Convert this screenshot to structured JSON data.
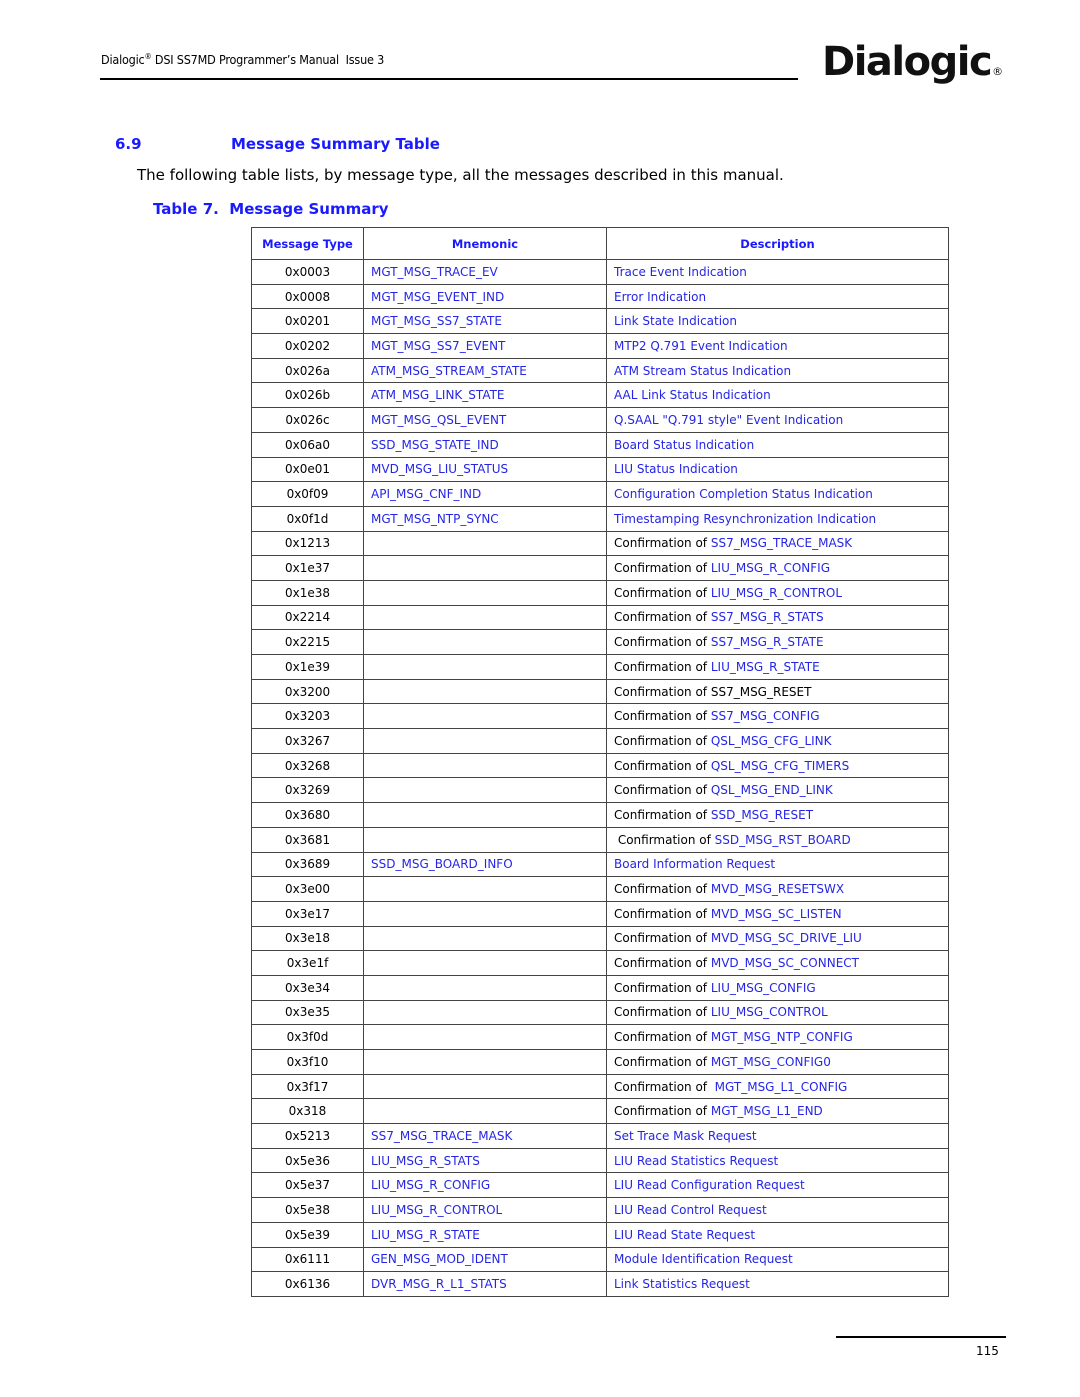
{
  "header": {
    "brand": "Dialogic",
    "reg_mark": "®",
    "title_rest": " DSI SS7MD Programmer’s Manual  Issue 3",
    "logo_text": "Dialogic",
    "logo_reg": "®"
  },
  "section": {
    "number": "6.9",
    "title": "Message Summary Table",
    "intro": "The following table lists, by message type, all the messages described in this manual."
  },
  "table": {
    "caption": "Table 7.  Message Summary",
    "columns": [
      "Message Type",
      "Mnemonic",
      "Description"
    ],
    "rows": [
      {
        "type": "0x0003",
        "mnemonic": "MGT_MSG_TRACE_EV",
        "desc_prefix": "",
        "desc": "Trace Event Indication",
        "desc_link": true
      },
      {
        "type": "0x0008",
        "mnemonic": "MGT_MSG_EVENT_IND",
        "desc_prefix": "",
        "desc": "Error Indication",
        "desc_link": true
      },
      {
        "type": "0x0201",
        "mnemonic": "MGT_MSG_SS7_STATE",
        "desc_prefix": "",
        "desc": "Link State Indication",
        "desc_link": true
      },
      {
        "type": "0x0202",
        "mnemonic": "MGT_MSG_SS7_EVENT",
        "desc_prefix": "",
        "desc": "MTP2 Q.791 Event Indication",
        "desc_link": true
      },
      {
        "type": "0x026a",
        "mnemonic": "ATM_MSG_STREAM_STATE",
        "desc_prefix": "",
        "desc": "ATM Stream Status Indication",
        "desc_link": true
      },
      {
        "type": "0x026b",
        "mnemonic": "ATM_MSG_LINK_STATE",
        "desc_prefix": "",
        "desc": "AAL Link Status Indication",
        "desc_link": true
      },
      {
        "type": "0x026c",
        "mnemonic": "MGT_MSG_QSL_EVENT",
        "desc_prefix": "",
        "desc": "Q.SAAL \"Q.791 style\" Event Indication",
        "desc_link": true
      },
      {
        "type": "0x06a0",
        "mnemonic": "SSD_MSG_STATE_IND",
        "desc_prefix": "",
        "desc": "Board Status Indication",
        "desc_link": true
      },
      {
        "type": "0x0e01",
        "mnemonic": "MVD_MSG_LIU_STATUS",
        "desc_prefix": "",
        "desc": "LIU Status Indication",
        "desc_link": true
      },
      {
        "type": "0x0f09",
        "mnemonic": "API_MSG_CNF_IND",
        "desc_prefix": "",
        "desc": "Configuration Completion Status Indication",
        "desc_link": true
      },
      {
        "type": "0x0f1d",
        "mnemonic": "MGT_MSG_NTP_SYNC",
        "desc_prefix": "",
        "desc": "Timestamping Resynchronization Indication",
        "desc_link": true
      },
      {
        "type": "0x1213",
        "mnemonic": "",
        "desc_prefix": "Confirmation of ",
        "desc": "SS7_MSG_TRACE_MASK",
        "desc_link": true
      },
      {
        "type": "0x1e37",
        "mnemonic": "",
        "desc_prefix": "Confirmation of ",
        "desc": "LIU_MSG_R_CONFIG",
        "desc_link": true
      },
      {
        "type": "0x1e38",
        "mnemonic": "",
        "desc_prefix": "Confirmation of ",
        "desc": "LIU_MSG_R_CONTROL",
        "desc_link": true
      },
      {
        "type": "0x2214",
        "mnemonic": "",
        "desc_prefix": "Confirmation of ",
        "desc": "SS7_MSG_R_STATS",
        "desc_link": true
      },
      {
        "type": "0x2215",
        "mnemonic": "",
        "desc_prefix": "Confirmation of ",
        "desc": "SS7_MSG_R_STATE",
        "desc_link": true
      },
      {
        "type": "0x1e39",
        "mnemonic": "",
        "desc_prefix": "Confirmation of ",
        "desc": "LIU_MSG_R_STATE",
        "desc_link": true
      },
      {
        "type": "0x3200",
        "mnemonic": "",
        "desc_prefix": "Confirmation of ",
        "desc": "SS7_MSG_RESET",
        "desc_link": false
      },
      {
        "type": "0x3203",
        "mnemonic": "",
        "desc_prefix": "Confirmation of ",
        "desc": "SS7_MSG_CONFIG",
        "desc_link": true
      },
      {
        "type": "0x3267",
        "mnemonic": "",
        "desc_prefix": "Confirmation of ",
        "desc": "QSL_MSG_CFG_LINK",
        "desc_link": true
      },
      {
        "type": "0x3268",
        "mnemonic": "",
        "desc_prefix": "Confirmation of ",
        "desc": "QSL_MSG_CFG_TIMERS",
        "desc_link": true
      },
      {
        "type": "0x3269",
        "mnemonic": "",
        "desc_prefix": "Confirmation of ",
        "desc": "QSL_MSG_END_LINK",
        "desc_link": true
      },
      {
        "type": "0x3680",
        "mnemonic": "",
        "desc_prefix": "Confirmation of ",
        "desc": "SSD_MSG_RESET",
        "desc_link": true
      },
      {
        "type": "0x3681",
        "mnemonic": "",
        "desc_prefix": " Confirmation of ",
        "desc": "SSD_MSG_RST_BOARD",
        "desc_link": true
      },
      {
        "type": "0x3689",
        "mnemonic": "SSD_MSG_BOARD_INFO",
        "desc_prefix": "",
        "desc": "Board Information Request",
        "desc_link": true
      },
      {
        "type": "0x3e00",
        "mnemonic": "",
        "desc_prefix": "Confirmation of ",
        "desc": "MVD_MSG_RESETSWX",
        "desc_link": true
      },
      {
        "type": "0x3e17",
        "mnemonic": "",
        "desc_prefix": "Confirmation of ",
        "desc": "MVD_MSG_SC_LISTEN",
        "desc_link": true
      },
      {
        "type": "0x3e18",
        "mnemonic": "",
        "desc_prefix": "Confirmation of ",
        "desc": "MVD_MSG_SC_DRIVE_LIU",
        "desc_link": true
      },
      {
        "type": "0x3e1f",
        "mnemonic": "",
        "desc_prefix": "Confirmation of ",
        "desc": "MVD_MSG_SC_CONNECT",
        "desc_link": true
      },
      {
        "type": "0x3e34",
        "mnemonic": "",
        "desc_prefix": "Confirmation of ",
        "desc": "LIU_MSG_CONFIG",
        "desc_link": true
      },
      {
        "type": "0x3e35",
        "mnemonic": "",
        "desc_prefix": "Confirmation of ",
        "desc": "LIU_MSG_CONTROL",
        "desc_link": true
      },
      {
        "type": "0x3f0d",
        "mnemonic": "",
        "desc_prefix": "Confirmation of ",
        "desc": "MGT_MSG_NTP_CONFIG",
        "desc_link": true
      },
      {
        "type": "0x3f10",
        "mnemonic": "",
        "desc_prefix": "Confirmation of ",
        "desc": "MGT_MSG_CONFIG0",
        "desc_link": true
      },
      {
        "type": "0x3f17",
        "mnemonic": "",
        "desc_prefix": "Confirmation of  ",
        "desc": "MGT_MSG_L1_CONFIG",
        "desc_link": true
      },
      {
        "type": "0x318",
        "mnemonic": "",
        "desc_prefix": "Confirmation of ",
        "desc": "MGT_MSG_L1_END",
        "desc_link": true
      },
      {
        "type": "0x5213",
        "mnemonic": "SS7_MSG_TRACE_MASK",
        "desc_prefix": "",
        "desc": "Set Trace Mask Request",
        "desc_link": true
      },
      {
        "type": "0x5e36",
        "mnemonic": "LIU_MSG_R_STATS",
        "desc_prefix": "",
        "desc": "LIU Read Statistics Request",
        "desc_link": true
      },
      {
        "type": "0x5e37",
        "mnemonic": "LIU_MSG_R_CONFIG",
        "desc_prefix": "",
        "desc": "LIU Read Configuration Request",
        "desc_link": true
      },
      {
        "type": "0x5e38",
        "mnemonic": "LIU_MSG_R_CONTROL",
        "desc_prefix": "",
        "desc": "LIU Read Control Request",
        "desc_link": true
      },
      {
        "type": "0x5e39",
        "mnemonic": "LIU_MSG_R_STATE",
        "desc_prefix": "",
        "desc": "LIU Read State Request",
        "desc_link": true
      },
      {
        "type": "0x6111",
        "mnemonic": "GEN_MSG_MOD_IDENT",
        "desc_prefix": "",
        "desc": "Module Identification Request",
        "desc_link": true
      },
      {
        "type": "0x6136",
        "mnemonic": "DVR_MSG_R_L1_STATS",
        "desc_prefix": "",
        "desc": "Link Statistics Request",
        "desc_link": true
      }
    ]
  },
  "footer": {
    "page_number": "115"
  }
}
